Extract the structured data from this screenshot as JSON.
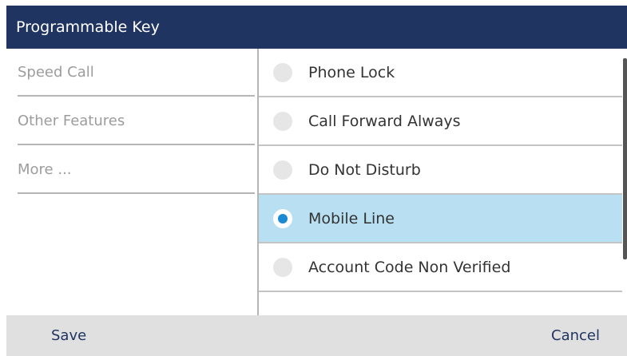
{
  "header": {
    "title": "Programmable Key"
  },
  "left_menu": {
    "items": [
      {
        "label": "Speed Call"
      },
      {
        "label": "Other Features"
      },
      {
        "label": "More ..."
      }
    ]
  },
  "options": {
    "items": [
      {
        "label": "Phone Lock",
        "selected": false
      },
      {
        "label": "Call Forward Always",
        "selected": false
      },
      {
        "label": "Do Not Disturb",
        "selected": false
      },
      {
        "label": "Mobile Line",
        "selected": true
      },
      {
        "label": "Account Code Non Verified",
        "selected": false
      }
    ]
  },
  "footer": {
    "save_label": "Save",
    "cancel_label": "Cancel"
  },
  "colors": {
    "title_bar": "#1f3461",
    "selected_row": "#b9e0f2",
    "radio_dot": "#1a8ad4",
    "footer_bg": "#e0e0e0"
  }
}
